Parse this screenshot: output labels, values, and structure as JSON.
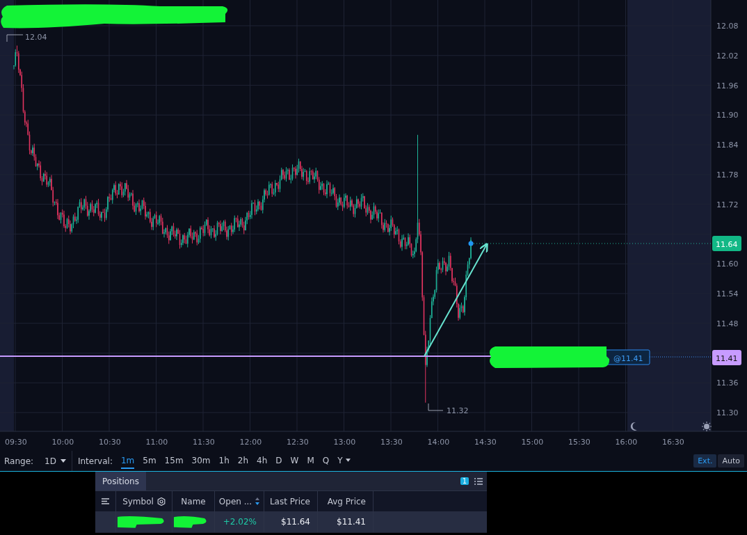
{
  "chart": {
    "y_axis_labels": [
      "12.08",
      "12.02",
      "11.96",
      "11.90",
      "11.84",
      "11.78",
      "11.72",
      "11.60",
      "11.54",
      "11.48",
      "11.36",
      "11.30"
    ],
    "time_labels": [
      "09:30",
      "10:00",
      "10:30",
      "11:00",
      "11:30",
      "12:00",
      "12:30",
      "13:00",
      "13:30",
      "14:00",
      "14:30",
      "15:00",
      "15:30",
      "16:00",
      "16:30"
    ],
    "high_marker": "12.04",
    "low_marker": "11.32",
    "last_price_tag": "11.64",
    "position_price_tag": "11.41",
    "order_label": "@11.41"
  },
  "toolbar": {
    "range_label": "Range:",
    "range_value": "1D",
    "interval_label": "Interval:",
    "intervals": [
      {
        "label": "1m",
        "selected": true,
        "has_menu": false
      },
      {
        "label": "5m",
        "selected": false,
        "has_menu": false
      },
      {
        "label": "15m",
        "selected": false,
        "has_menu": false
      },
      {
        "label": "30m",
        "selected": false,
        "has_menu": false
      },
      {
        "label": "1h",
        "selected": false,
        "has_menu": false
      },
      {
        "label": "2h",
        "selected": false,
        "has_menu": false
      },
      {
        "label": "4h",
        "selected": false,
        "has_menu": false
      },
      {
        "label": "D",
        "selected": false,
        "has_menu": false
      },
      {
        "label": "W",
        "selected": false,
        "has_menu": false
      },
      {
        "label": "M",
        "selected": false,
        "has_menu": false
      },
      {
        "label": "Q",
        "selected": false,
        "has_menu": false
      },
      {
        "label": "Y",
        "selected": false,
        "has_menu": true
      }
    ],
    "view_buttons": [
      {
        "label": "Ext.",
        "selected": true
      },
      {
        "label": "Auto",
        "selected": false
      }
    ]
  },
  "positions": {
    "tab": "Positions",
    "count": "1",
    "columns": [
      {
        "kind": "menu"
      },
      {
        "kind": "settings",
        "label": "Symbol"
      },
      {
        "kind": "plain",
        "label": "Name"
      },
      {
        "kind": "sort",
        "label": "Open ..."
      },
      {
        "kind": "plain",
        "label": "Last Price"
      },
      {
        "kind": "plain",
        "label": "Avg Price"
      }
    ],
    "row": [
      {
        "kind": "empty"
      },
      {
        "kind": "redacted"
      },
      {
        "kind": "redacted"
      },
      {
        "kind": "gain",
        "text": "+2.02%"
      },
      {
        "kind": "price",
        "text": "$11.64"
      },
      {
        "kind": "price",
        "text": "$11.41"
      }
    ]
  }
}
